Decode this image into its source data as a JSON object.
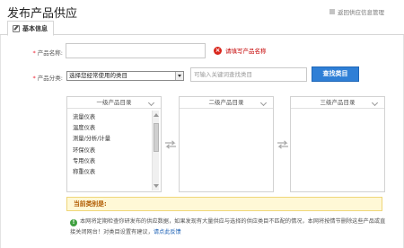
{
  "page": {
    "title": "发布产品供应",
    "back_link": "返回供应信息管理"
  },
  "tabs": [
    {
      "label": "基本信息"
    }
  ],
  "form": {
    "product_name": {
      "label": "产品名称:",
      "value": "",
      "error": "请填写产品名称"
    },
    "product_category": {
      "label": "产品分类:",
      "selected": "选择您经常使用的类目",
      "search_placeholder": "可输入关键词查找类目",
      "search_button": "查找类目"
    }
  },
  "category_selector": {
    "level1": {
      "header": "一级产品目录",
      "items": [
        "流量仪表",
        "温度仪表",
        "测量/分析/计量",
        "环保仪表",
        "专用仪表",
        "称重仪表"
      ]
    },
    "level2": {
      "header": "二级产品目录"
    },
    "level3": {
      "header": "三级产品目录"
    }
  },
  "current_category": {
    "label": "当前类别是:",
    "value": ""
  },
  "notice": {
    "text": "本网将定期检查你研发布的供应数据，如果发现有大量供应与选择的供应类目不匹配的情况，本网将按情节删除这些产品或直接关闭网台！对类目设置有建议，",
    "link": "请点此反馈"
  },
  "colors": {
    "primary_button": "#2f7fd6",
    "error": "#c40000",
    "current_bar_bg": "#fff8d6",
    "current_bar_text": "#b05a00",
    "info_icon": "#3fa040"
  }
}
